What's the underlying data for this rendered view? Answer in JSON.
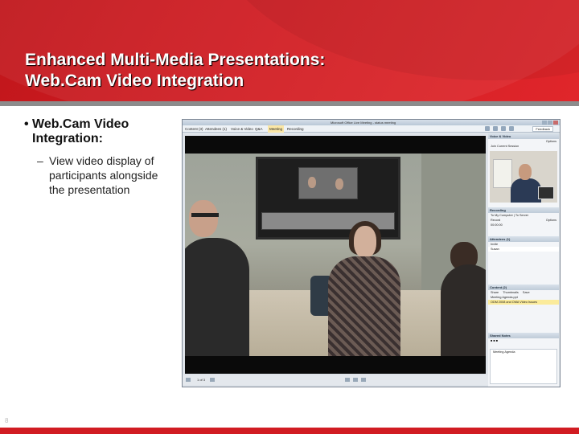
{
  "slide": {
    "title_line1": "Enhanced Multi-Media Presentations:",
    "title_line2": "Web.Cam Video Integration",
    "bullet_marker": "•",
    "bullet_main": "Web.Cam Video Integration:",
    "sub_marker": "–",
    "sub_bullet": "View video display of participants alongside the presentation",
    "page_number": "8",
    "colors": {
      "brand_red": "#d11c22",
      "band_grey": "#8c8c8c"
    }
  },
  "app_window": {
    "title": "Microsoft Office Live Meeting - status meeting",
    "menu": [
      "Content (3)",
      "Attendees (1)",
      "Voice & Video",
      "Q&A",
      "Meeting",
      "Recording"
    ],
    "selected_menu": "Meeting",
    "feedback_label": "Feedback",
    "page_indicator": "1 of 3",
    "panel": {
      "voice_video": {
        "header": "Voice & Video",
        "options_label": "Options",
        "join_label": "Join Current Session"
      },
      "recording": {
        "header": "Recording",
        "tab_computer": "To My Computer",
        "tab_server": "To Server",
        "record_label": "Record",
        "options_label": "Options",
        "timer": "00:00:00"
      },
      "attendees": {
        "header": "Attendees (1)",
        "toolbar": "Invite",
        "row": "Susan"
      },
      "content": {
        "header": "Content (2)",
        "toolbar_share": "Share",
        "toolbar_thumbnails": "Thumbnails",
        "toolbar_save": "Save",
        "item1": "Meeting Agenda.ppt",
        "item2": "ODM 2008 and OMA Video Issues"
      },
      "shared_notes": {
        "header": "Shared Notes",
        "text": "Meeting Agenda"
      }
    }
  }
}
